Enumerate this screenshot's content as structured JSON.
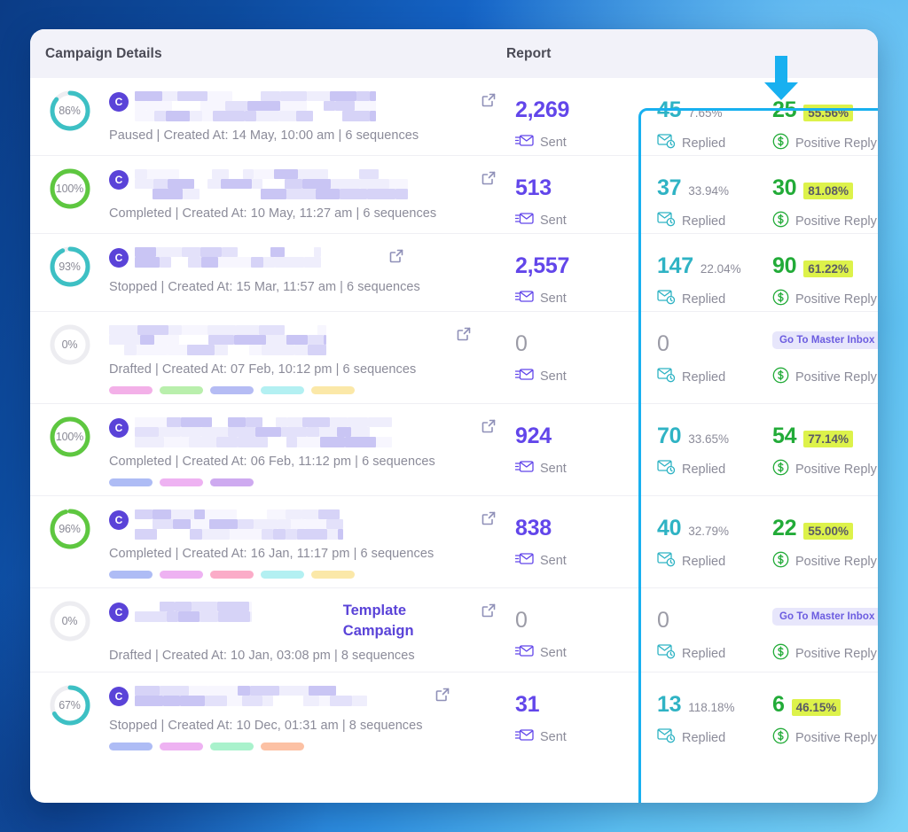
{
  "header": {
    "campaign_details_label": "Campaign Details",
    "report_label": "Report",
    "arrow_icon": "down-arrow-icon",
    "arrow_color": "#18b0f0"
  },
  "highlight": {
    "color": "#18b0f0"
  },
  "labels": {
    "sent": "Sent",
    "replied": "Replied",
    "positive_reply": "Positive Reply",
    "master_inbox": "Go To Master Inbox",
    "avatar_initial": "C"
  },
  "colors": {
    "sent": "#6246ea",
    "replied": "#2fb3c4",
    "positive": "#22ab38",
    "highlight_pct_bg": "#ddf24a",
    "ring_teal": "#3dc0c4",
    "ring_green": "#5ec740",
    "ring_track": "#ededf1",
    "avatar": "#5a43d8",
    "badge_bg": "#e7e6fb",
    "badge_text": "#6b5ce0"
  },
  "rows": [
    {
      "progress": "86%",
      "progress_value": 86,
      "ring_color": "#3dc0c4",
      "has_avatar": true,
      "name_visible": "",
      "meta": "Paused | Created At: 14 May, 10:00 am | 6 sequences",
      "status": "Paused",
      "created_at": "14 May, 10:00 am",
      "sequences": "6 sequences",
      "sent": "2,269",
      "replied": "45",
      "replied_pct": "7.65%",
      "positive": "25",
      "positive_pct": "55.56%",
      "show_inbox_badge": false,
      "pills": []
    },
    {
      "progress": "100%",
      "progress_value": 100,
      "ring_color": "#5ec740",
      "has_avatar": true,
      "name_visible": "",
      "meta": "Completed | Created At: 10 May, 11:27 am | 6 sequences",
      "status": "Completed",
      "created_at": "10 May, 11:27 am",
      "sequences": "6 sequences",
      "sent": "513",
      "replied": "37",
      "replied_pct": "33.94%",
      "positive": "30",
      "positive_pct": "81.08%",
      "show_inbox_badge": false,
      "pills": []
    },
    {
      "progress": "93%",
      "progress_value": 93,
      "ring_color": "#3dc0c4",
      "has_avatar": true,
      "name_visible": "",
      "meta": "Stopped | Created At: 15 Mar, 11:57 am | 6 sequences",
      "status": "Stopped",
      "created_at": "15 Mar, 11:57 am",
      "sequences": "6 sequences",
      "sent": "2,557",
      "replied": "147",
      "replied_pct": "22.04%",
      "positive": "90",
      "positive_pct": "61.22%",
      "show_inbox_badge": false,
      "pills": []
    },
    {
      "progress": "0%",
      "progress_value": 0,
      "ring_color": "#ededf1",
      "has_avatar": false,
      "name_visible": "",
      "meta": "Drafted | Created At: 07 Feb, 10:12 pm | 6 sequences",
      "status": "Drafted",
      "created_at": "07 Feb, 10:12 pm",
      "sequences": "6 sequences",
      "sent": "0",
      "replied": "0",
      "replied_pct": "",
      "positive": "",
      "positive_pct": "",
      "show_inbox_badge": true,
      "pills": [
        "#f3b0e8",
        "#b9efac",
        "#b5bcf4",
        "#b3f0f2",
        "#fbe8a8"
      ]
    },
    {
      "progress": "100%",
      "progress_value": 100,
      "ring_color": "#5ec740",
      "has_avatar": true,
      "name_visible": "",
      "meta": "Completed | Created At: 06 Feb, 11:12 pm | 6 sequences",
      "status": "Completed",
      "created_at": "06 Feb, 11:12 pm",
      "sequences": "6 sequences",
      "sent": "924",
      "replied": "70",
      "replied_pct": "33.65%",
      "positive": "54",
      "positive_pct": "77.14%",
      "show_inbox_badge": false,
      "pills": [
        "#aebcf5",
        "#eeb2f2",
        "#ceaaf0"
      ]
    },
    {
      "progress": "96%",
      "progress_value": 96,
      "ring_color": "#5ec740",
      "has_avatar": true,
      "name_visible": "",
      "meta": "Completed | Created At: 16 Jan, 11:17 pm | 6 sequences",
      "status": "Completed",
      "created_at": "16 Jan, 11:17 pm",
      "sequences": "6 sequences",
      "sent": "838",
      "replied": "40",
      "replied_pct": "32.79%",
      "positive": "22",
      "positive_pct": "55.00%",
      "show_inbox_badge": false,
      "pills": [
        "#aebcf5",
        "#eeb2f2",
        "#fbacc8",
        "#b3f0f2",
        "#fbe8a8"
      ]
    },
    {
      "progress": "0%",
      "progress_value": 0,
      "ring_color": "#ededf1",
      "has_avatar": true,
      "name_visible": "Template Campaign",
      "meta": "Drafted | Created At: 10 Jan, 03:08 pm | 8 sequences",
      "status": "Drafted",
      "created_at": "10 Jan, 03:08 pm",
      "sequences": "8 sequences",
      "sent": "0",
      "replied": "0",
      "replied_pct": "",
      "positive": "",
      "positive_pct": "",
      "show_inbox_badge": true,
      "pills": []
    },
    {
      "progress": "67%",
      "progress_value": 67,
      "ring_color": "#3dc0c4",
      "has_avatar": true,
      "name_visible": "",
      "meta": "Stopped | Created At: 10 Dec, 01:31 am | 8 sequences",
      "status": "Stopped",
      "created_at": "10 Dec, 01:31 am",
      "sequences": "8 sequences",
      "sent": "31",
      "replied": "13",
      "replied_pct": "118.18%",
      "positive": "6",
      "positive_pct": "46.15%",
      "show_inbox_badge": false,
      "pills": [
        "#aebcf5",
        "#eeb2f2",
        "#a9f2cc",
        "#fcc1a4"
      ]
    }
  ]
}
